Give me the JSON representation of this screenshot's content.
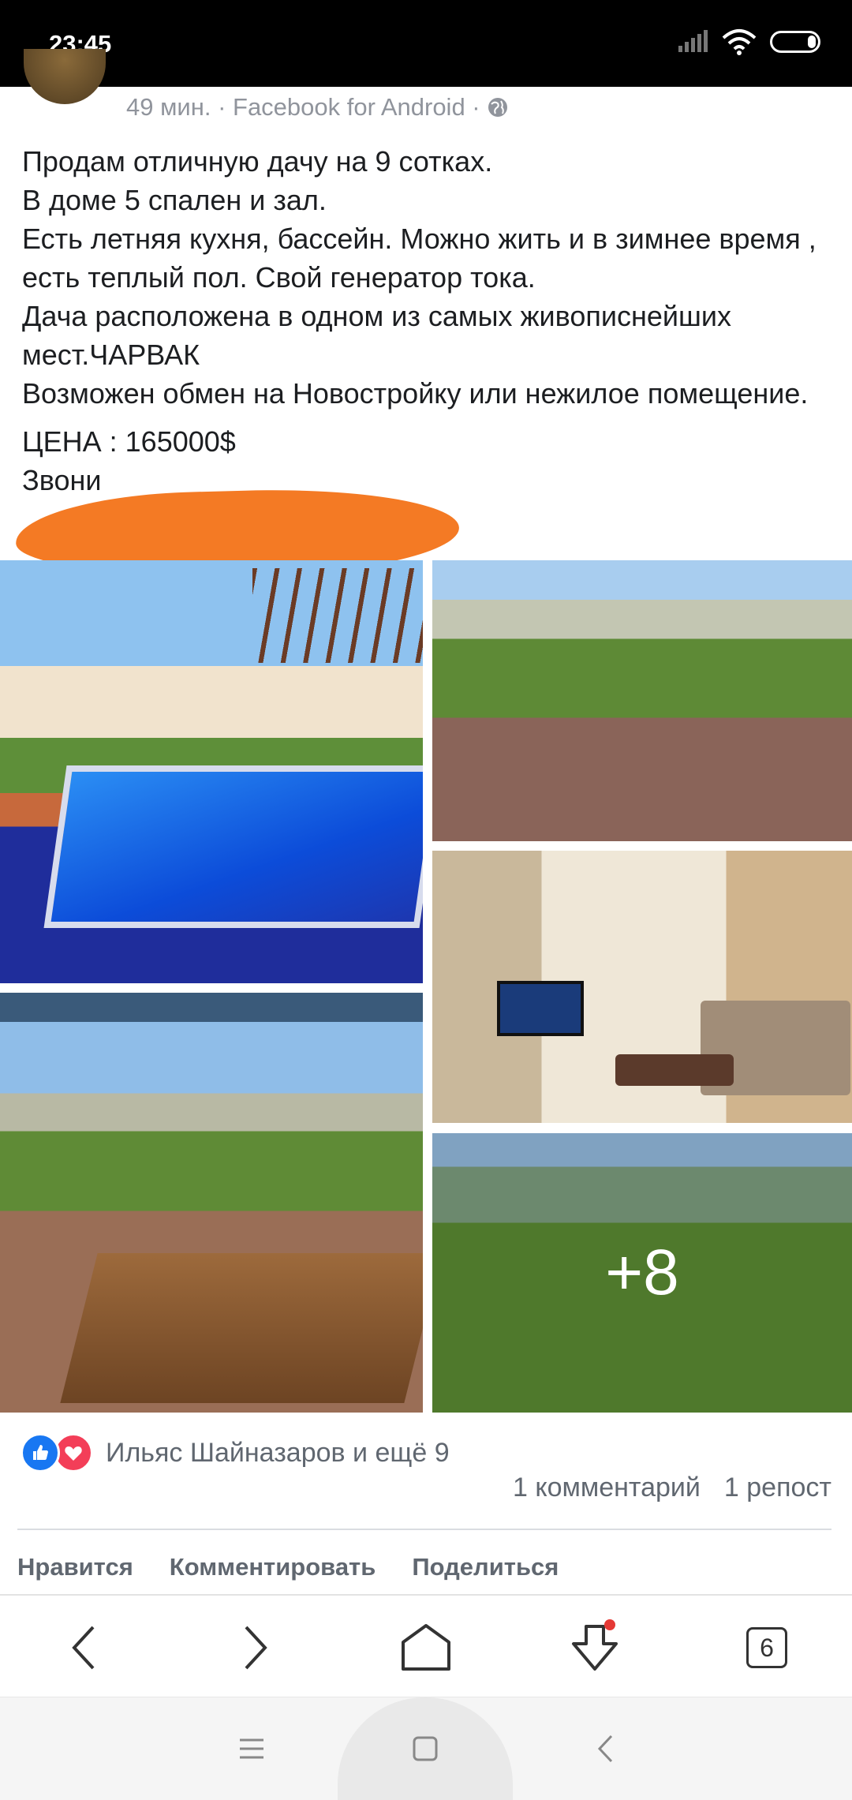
{
  "status_bar": {
    "time": "23:45"
  },
  "post": {
    "meta": "49 мин. · Facebook for Android ·",
    "lines": [
      "Продам отличную дачу на 9 сотках.",
      "В доме 5 спален и зал.",
      "Есть летняя кухня, бассейн. Можно жить и в зимнее время , есть теплый пол. Свой генератор тока.",
      "Дача расположена в одном из самых живописнейших мест.ЧАРВАК",
      "Возможен обмен на Новостройку или нежилое помещение."
    ],
    "price": "ЦЕНА : 165000$",
    "phone_prefix": "Звони",
    "more_photos": "+8"
  },
  "reactions": {
    "names": "Ильяс Шайназаров и ещё 9",
    "comments": "1 комментарий",
    "shares": "1 репост"
  },
  "actions": {
    "like": "Нравится",
    "comment": "Комментировать",
    "share": "Поделиться"
  },
  "toolbar": {
    "tabs_count": "6"
  },
  "colors": {
    "redaction": "#f47a24",
    "like_blue": "#1877f2",
    "love_red": "#f33e58",
    "meta_gray": "#90949c"
  }
}
